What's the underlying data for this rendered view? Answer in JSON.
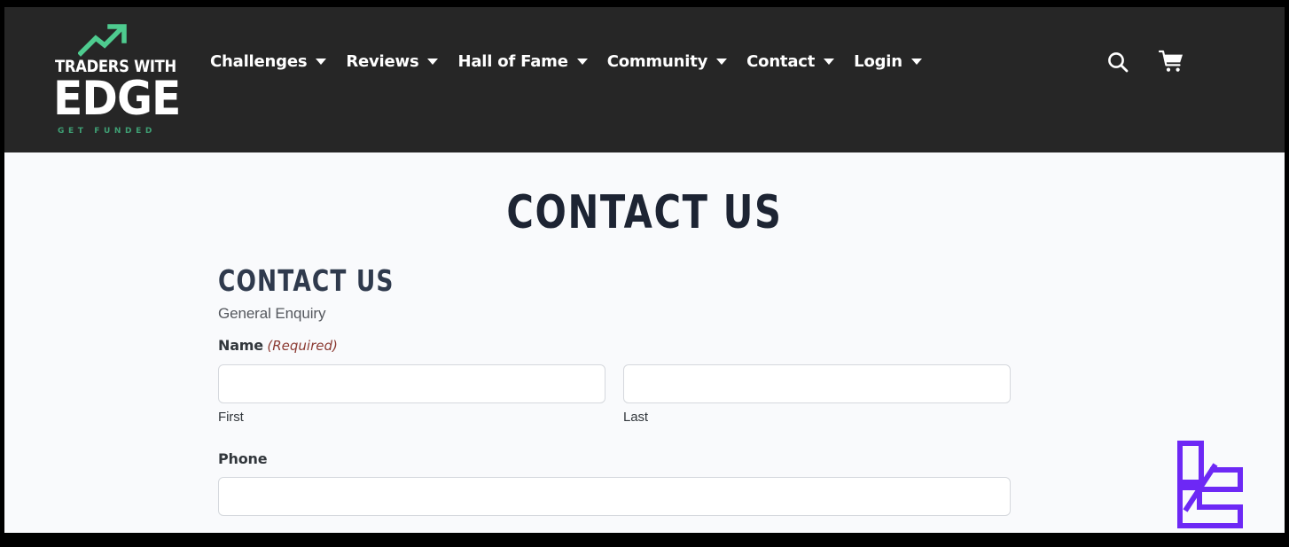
{
  "header": {
    "logo": {
      "line1": "TRADERS WITH",
      "line2": "EDGE",
      "tagline": "GET FUNDED",
      "arrow_icon": "trending-up-arrow-icon",
      "arrow_color": "#4ecb8f",
      "tagline_color": "#3f9f74"
    },
    "background_color": "#262626",
    "nav": [
      {
        "label": "Challenges",
        "has_dropdown": true
      },
      {
        "label": "Reviews",
        "has_dropdown": true
      },
      {
        "label": "Hall of Fame",
        "has_dropdown": true
      },
      {
        "label": "Community",
        "has_dropdown": true
      },
      {
        "label": "Contact",
        "has_dropdown": true
      },
      {
        "label": "Login",
        "has_dropdown": true
      }
    ],
    "actions": [
      {
        "icon": "search-icon"
      },
      {
        "icon": "cart-icon"
      }
    ]
  },
  "page": {
    "title": "CONTACT US",
    "background_color": "#f9fafc",
    "title_color": "#1d2433"
  },
  "form": {
    "heading": "CONTACT US",
    "subheading": "General Enquiry",
    "name_field": {
      "label": "Name",
      "required_marker": "(Required)",
      "required_color": "#8b3a32",
      "first": {
        "value": "",
        "placeholder": "",
        "sub_label": "First"
      },
      "last": {
        "value": "",
        "placeholder": "",
        "sub_label": "Last"
      }
    },
    "phone_field": {
      "label": "Phone",
      "value": "",
      "placeholder": ""
    }
  },
  "watermark": {
    "icon": "monogram-logo-icon",
    "color": "#6d28f5"
  }
}
